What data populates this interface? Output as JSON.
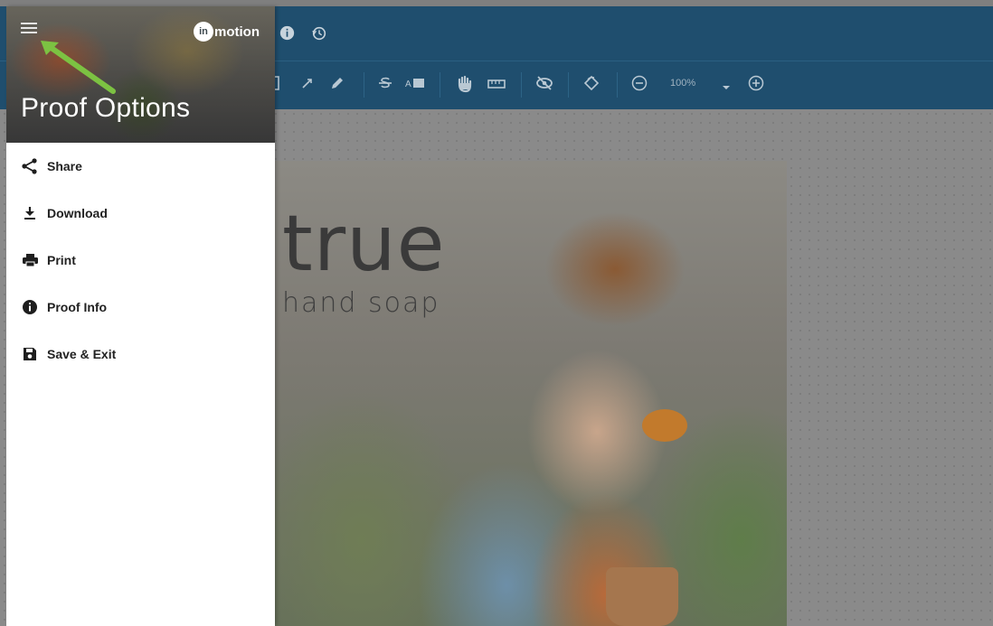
{
  "app": {
    "logo_text": "motion",
    "logo_badge": "in",
    "topbar_icons": [
      "info-icon",
      "history-icon"
    ]
  },
  "toolbar": {
    "tools": [
      "rectangle-icon",
      "arrow-icon",
      "pen-icon",
      "strikethrough-icon",
      "replace-text-icon",
      "hand-icon",
      "ruler-icon",
      "hide-icon",
      "rotate-icon",
      "zoom-out-icon",
      "zoom-dropdown-icon",
      "zoom-in-icon"
    ],
    "zoom_value": "100%"
  },
  "proof": {
    "headline": "true",
    "subline": "hand soap"
  },
  "drawer": {
    "title": "Proof Options",
    "items": [
      {
        "label": "Share",
        "icon": "share-icon"
      },
      {
        "label": "Download",
        "icon": "download-icon"
      },
      {
        "label": "Print",
        "icon": "print-icon"
      },
      {
        "label": "Proof Info",
        "icon": "info-icon"
      },
      {
        "label": "Save & Exit",
        "icon": "save-icon"
      }
    ]
  },
  "colors": {
    "topbar": "#1f4e6e",
    "drawer_bg": "#ffffff",
    "annotation_arrow": "#7cc242"
  }
}
